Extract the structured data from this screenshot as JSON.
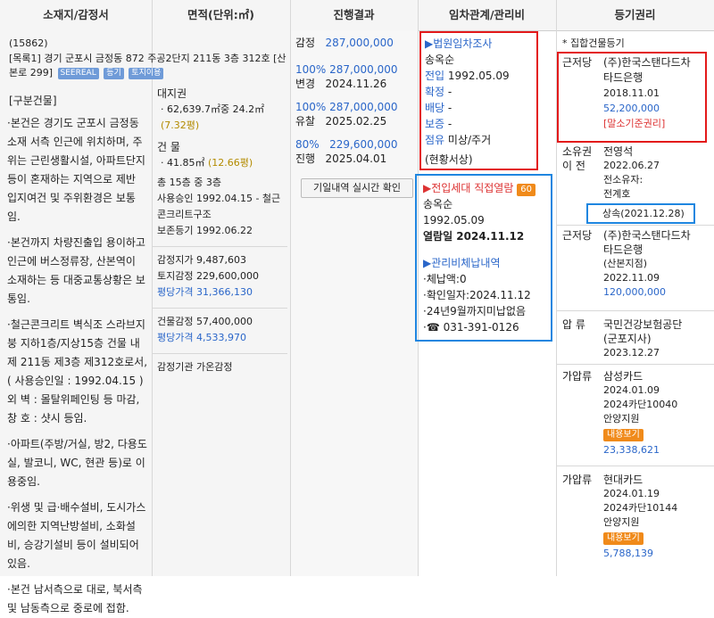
{
  "headers": {
    "location": "소재지/감정서",
    "area": "면적(단위:㎡)",
    "result": "진행결과",
    "lease": "임차관계/관리비",
    "rights": "등기권리"
  },
  "location": {
    "code": "(15862)",
    "address": "[목록1] 경기 군포시 금정동 872 주공2단지 211동 3층 312호 [산본로 299]",
    "tags": [
      "SEEREAL",
      "등기",
      "토지이용"
    ],
    "bldg_header": "[구분건물]",
    "paragraphs": [
      "·본건은 경기도 군포시 금정동 소재 서측 인근에 위치하며, 주위는 근린생활시설, 아파트단지 등이 혼재하는 지역으로 제반 입지여건 및 주위환경은 보통임.",
      "·본건까지 차량진출입 용이하고 인근에 버스정류장, 산본역이 소재하는 등 대중교통상황은 보통임.",
      "·철근콘크리트 벽식조 스라브지붕 지하1층/지상15층 건물 내 제 211동 제3층 제312호로서,( 사용승인일 : 1992.04.15 )외 벽 : 몰탈위페인팅 등 마감,창 호 : 샷시 등임.",
      "·아파트(주방/거실, 방2, 다용도실, 발코니, WC, 현관 등)로 이용중임.",
      "·위생 및 급·배수설비, 도시가스에의한 지역난방설비, 소화설비, 승강기설비 등이 설비되어 있음.",
      "·본건 남서측으로 대로, 북서측 및 남동측으로 중로에 접함."
    ]
  },
  "area": {
    "land_label": "대지권",
    "land_value": "62,639.7㎡중 24.2㎡",
    "land_pyeong": "(7.32평)",
    "bldg_label": "건 물",
    "bldg_value": "41.85㎡",
    "bldg_pyeong": "(12.66평)",
    "floor": "총 15층 중 3층",
    "approval": "사용승인 1992.04.15 - 철근콘크리트구조",
    "reg": "보존등기 1992.06.22",
    "land_appraisal": "감정지가 9,487,603",
    "land_gamjeong": "토지감정 229,600,000",
    "land_unit": "평당가격 31,366,130",
    "bldg_gamjeong": "건물감정 57,400,000",
    "bldg_unit": "평당가격 4,533,970",
    "agency": "감정기관 가온감정"
  },
  "result": {
    "appraisal_label": "감정",
    "appraisal_value": "287,000,000",
    "rows": [
      {
        "pct": "100%",
        "amount": "287,000,000",
        "status": "변경",
        "date": "2024.11.26"
      },
      {
        "pct": "100%",
        "amount": "287,000,000",
        "status": "유찰",
        "date": "2025.02.25"
      },
      {
        "pct": "80%",
        "amount": "229,600,000",
        "status": "진행",
        "date": "2025.04.01"
      }
    ],
    "history_button": "기일내역 실시간 확인"
  },
  "lease": {
    "court_title": "▶법원임차조사",
    "tenant": "송옥순",
    "move_label": "전입",
    "move_value": "1992.05.09",
    "fixed_label": "확정",
    "fixed_value": "-",
    "dist_label": "배당",
    "dist_value": "-",
    "deposit_label": "보증",
    "deposit_value": "-",
    "occupy_label": "점유",
    "occupy_value": "미상/주거",
    "note": "(현황서상)",
    "resident_title": "▶전입세대 직접열람",
    "resident_badge": "60",
    "resident_name": "송옥순",
    "resident_date": "1992.05.09",
    "view_date": "열람일 2024.11.12",
    "mgmt_title": "▶관리비체납내역",
    "mgmt_lines": [
      "·체납액:0",
      "·확인일자:2024.11.12",
      "·24년9월까지미납없음",
      "·☎ 031-391-0126"
    ]
  },
  "rights": {
    "title": "* 집합건물등기",
    "entries": [
      {
        "type": "근저당",
        "lines": [
          "(주)한국스탠다드차",
          "타드은행",
          "2018.11.01"
        ],
        "amount": "52,200,000",
        "note": "[말소기준권리]"
      },
      {
        "type": "소유권 이 전",
        "lines": [
          "전영석",
          "2022.06.27",
          "전소유자:",
          "전계호"
        ],
        "note2": "상속(2021.12.28)"
      },
      {
        "type": "근저당",
        "lines": [
          "(주)한국스탠다드차",
          "타드은행",
          "(산본지점)",
          "2022.11.09"
        ],
        "amount": "120,000,000"
      },
      {
        "type": "압 류",
        "lines": [
          "국민건강보험공단",
          "(군포지사)",
          "2023.12.27"
        ]
      },
      {
        "type": "가압류",
        "lines": [
          "삼성카드",
          "2024.01.09",
          "2024카단10040",
          "안양지원"
        ],
        "badge": "내용보기",
        "amount": "23,338,621"
      },
      {
        "type": "가압류",
        "lines": [
          "현대카드",
          "2024.01.19",
          "2024카단10144",
          "안양지원"
        ],
        "badge": "내용보기",
        "amount": "5,788,139"
      }
    ]
  }
}
